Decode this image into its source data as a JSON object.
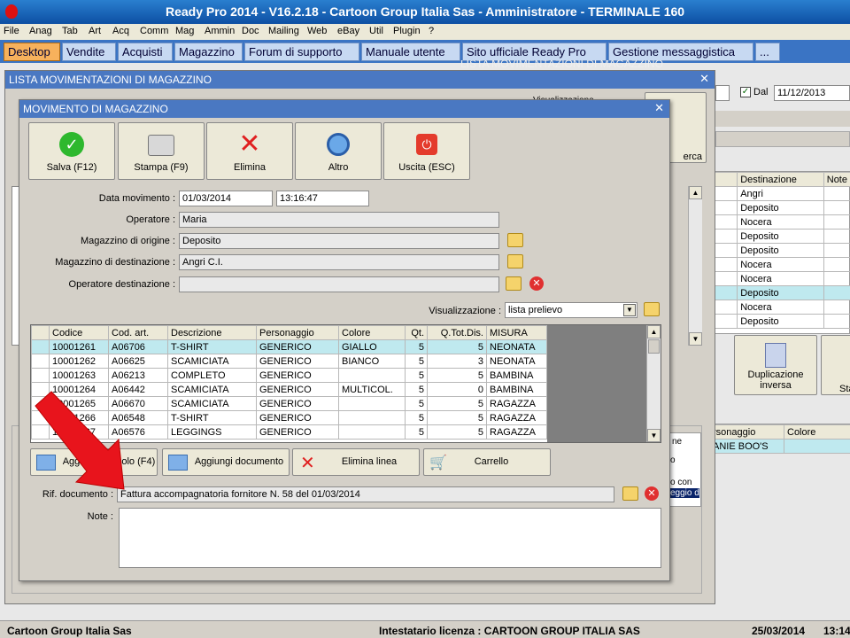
{
  "window": {
    "title": "Ready Pro 2014 - V16.2.18 - Cartoon Group Italia Sas - Amministratore - TERMINALE 160"
  },
  "menu": [
    "File",
    "Anag",
    "Tab",
    "Art",
    "Acq",
    "Comm",
    "Mag",
    "Ammin",
    "Doc",
    "Mailing",
    "Web",
    "eBay",
    "Util",
    "Plugin",
    "?"
  ],
  "tabs": [
    "Desktop",
    "Vendite",
    "Acquisti",
    "Magazzino",
    "Forum di supporto",
    "Manuale utente",
    "Sito ufficiale Ready Pro",
    "Gestione messaggistica",
    "..."
  ],
  "back_window": {
    "title": "LISTA MOVIMENTAZIONI DI MAGAZZINO",
    "header_ghost": "LISTA MOVIMENTAZIONI DI MAGAZZINO",
    "visualizzazione_label": "Visualizzazione",
    "dal_label": "Dal",
    "dal_value": "11/12/2013",
    "cerca_label": "erca",
    "dest_header": "Destinazione",
    "note_header": "Note",
    "destinations": [
      "Angri",
      "Deposito",
      "Nocera",
      "Deposito",
      "Deposito",
      "Nocera",
      "Nocera",
      "Deposito",
      "Nocera",
      "Deposito"
    ],
    "dup_label1": "Duplicazione",
    "dup_label2": "inversa",
    "sta_label": "Sta",
    "pers_header": "rsonaggio",
    "colore_header": "Colore",
    "pers_row": "ANIE BOO'S",
    "side_ne": "ne",
    "side_o": "o",
    "side_con": "o con",
    "side_sel": "eggio d"
  },
  "dialog": {
    "title": "MOVIMENTO DI MAGAZZINO",
    "toolbar": {
      "save": "Salva (F12)",
      "print": "Stampa (F9)",
      "delete": "Elimina",
      "other": "Altro",
      "exit": "Uscita (ESC)"
    },
    "labels": {
      "date": "Data movimento :",
      "operator": "Operatore :",
      "origin": "Magazzino di origine :",
      "dest": "Magazzino di destinazione :",
      "dest_operator": "Operatore destinazione :",
      "view": "Visualizzazione :",
      "rif": "Rif. documento :",
      "note": "Note :"
    },
    "values": {
      "date": "01/03/2014",
      "time": "13:16:47",
      "operator": "Maria",
      "origin": "Deposito",
      "dest": "Angri C.I.",
      "dest_operator": "",
      "view": "lista prelievo",
      "rif": "Fattura accompagnatoria fornitore N. 58 del 01/03/2014",
      "note": ""
    },
    "grid": {
      "headers": [
        "Codice",
        "Cod. art.",
        "Descrizione",
        "Personaggio",
        "Colore",
        "Qt.",
        "Q.Tot.Dis.",
        "MISURA"
      ],
      "rows": [
        [
          "10001261",
          "A06706",
          "T-SHIRT",
          "GENERICO",
          "GIALLO",
          "5",
          "5",
          "NEONATA"
        ],
        [
          "10001262",
          "A06625",
          "SCAMICIATA",
          "GENERICO",
          "BIANCO",
          "5",
          "3",
          "NEONATA"
        ],
        [
          "10001263",
          "A06213",
          "COMPLETO",
          "GENERICO",
          "",
          "5",
          "5",
          "BAMBINA"
        ],
        [
          "10001264",
          "A06442",
          "SCAMICIATA",
          "GENERICO",
          "MULTICOL.",
          "5",
          "0",
          "BAMBINA"
        ],
        [
          "10001265",
          "A06670",
          "SCAMICIATA",
          "GENERICO",
          "",
          "5",
          "5",
          "RAGAZZA"
        ],
        [
          "10001266",
          "A06548",
          "T-SHIRT",
          "GENERICO",
          "",
          "5",
          "5",
          "RAGAZZA"
        ],
        [
          "10001267",
          "A06576",
          "LEGGINGS",
          "GENERICO",
          "",
          "5",
          "5",
          "RAGAZZA"
        ]
      ]
    },
    "bottom_buttons": {
      "add_article": "Aggiungi articolo (F4)",
      "add_document": "Aggiungi documento",
      "delete_line": "Elimina linea",
      "cart": "Carrello"
    }
  },
  "statusbar": {
    "company": "Cartoon Group Italia Sas",
    "license": "Intestatario licenza : CARTOON GROUP ITALIA SAS",
    "date": "25/03/2014",
    "time": "13:14"
  },
  "colors": {
    "title_blue": "#0d4fa3",
    "tab_active": "#f7b15c",
    "selected_row": "#bfe9ef",
    "arrow_red": "#e8141c"
  }
}
